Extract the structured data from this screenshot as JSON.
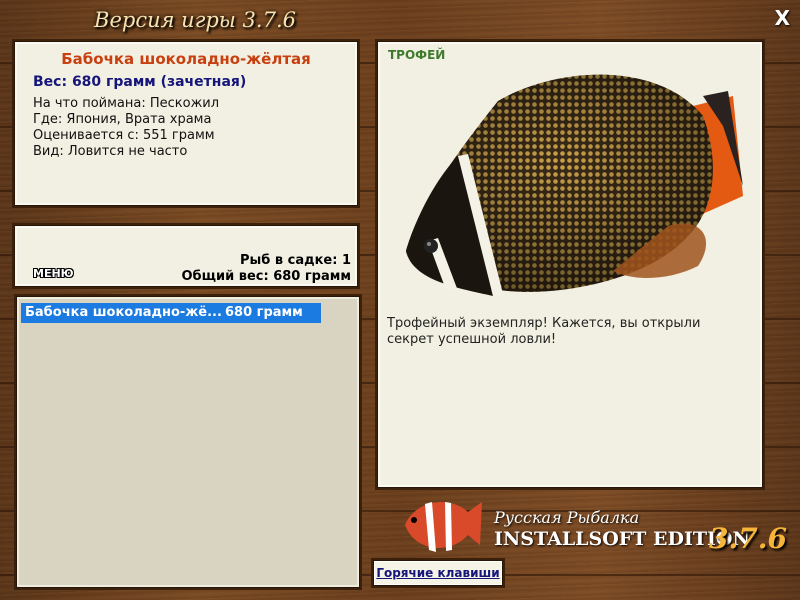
{
  "window": {
    "title": "Версия игры 3.7.6",
    "close_label": "X"
  },
  "fish_info": {
    "name": "Бабочка шоколадно-жёлтая",
    "weight": "Вес: 680 грамм (зачетная)",
    "bait": "На что поймана: Пескожил",
    "location": "Где: Япония, Врата храма",
    "rated_from": "Оценивается с: 551 грамм",
    "rarity": "Вид: Ловится не часто"
  },
  "cage": {
    "menu_label": "МЕНЮ",
    "fish_count": "Рыб в садке: 1",
    "total_weight": "Общий вес: 680 грамм"
  },
  "catch_list": [
    {
      "name": "Бабочка шоколадно-жё...",
      "weight": "680 грамм"
    }
  ],
  "trophy": {
    "label": "ТРОФЕЙ",
    "message": "Трофейный экземпляр! Кажется, вы открыли секрет успешной ловли!"
  },
  "branding": {
    "line1": "Русская Рыбалка",
    "line2": "INSTALLSOFT EDITION",
    "version": "3.7.6"
  },
  "hotkeys_label": "Горячие клавиши",
  "colors": {
    "accent_name": "#c84010",
    "accent_weight": "#15157a",
    "selection": "#1c7be0",
    "trophy_label": "#3f7a2c"
  }
}
